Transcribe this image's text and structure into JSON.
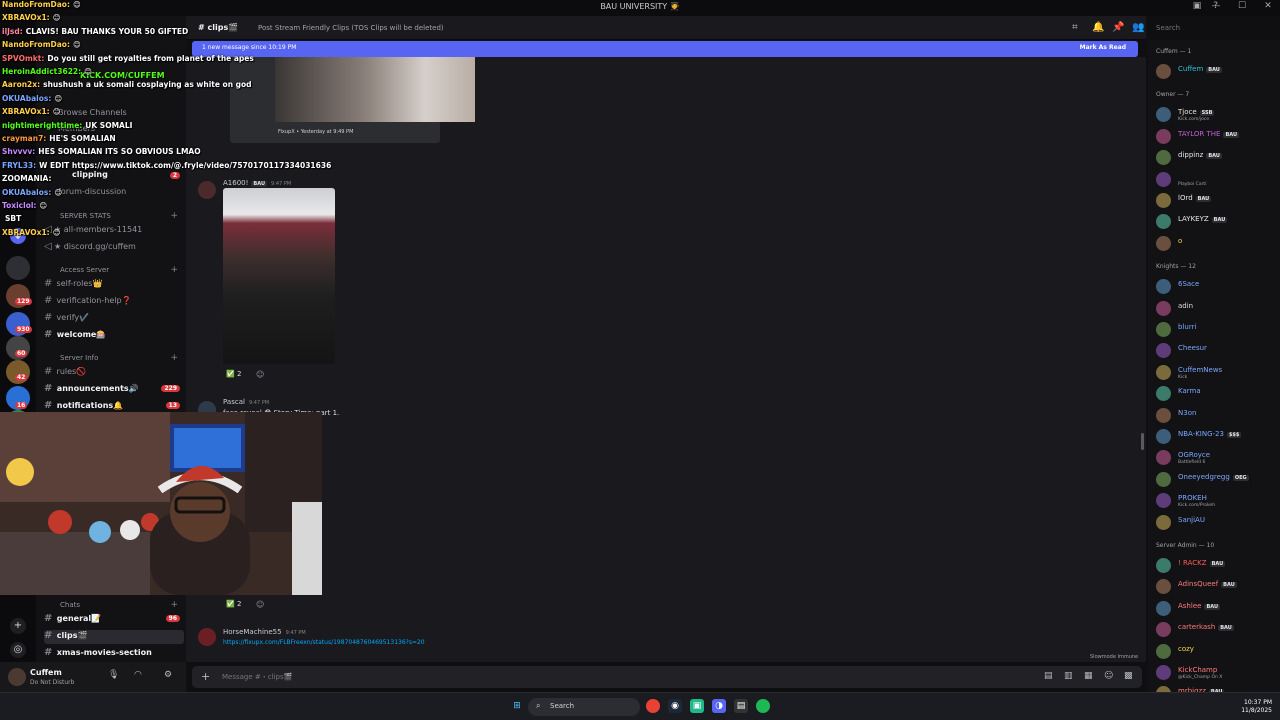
{
  "window": {
    "title": "BAU UNIVERSITY 🧑‍🎓"
  },
  "server_rail": {
    "badges": [
      "129",
      "930",
      "60",
      "42",
      "16"
    ]
  },
  "channels": {
    "top_items": [
      "Browse Channels",
      "Members",
      "clipping",
      "forum-discussion"
    ],
    "top_badge": "2",
    "server_stats_cat": "SERVER STATS",
    "stat_channels": [
      "★ all-members-11541",
      "★ discord.gg/cuffem"
    ],
    "access_cat": "Access Server",
    "access_channels": [
      "self-roles👑",
      "verification-help❓",
      "verify✔️"
    ],
    "welcome": "welcome🎰",
    "info_cat": "Server Info",
    "rules": "rules🚫",
    "announcements": "announcements🔊",
    "announcements_badge": "229",
    "notifications": "notifications🔔",
    "notifications_badge": "13",
    "chats_cat": "Chats",
    "general": "general📝",
    "general_badge": "96",
    "clips": "clips🎬",
    "xmas": "xmas-movies-section"
  },
  "user_panel": {
    "name": "Cuffem",
    "status": "Do Not Disturb"
  },
  "header": {
    "channel": "clips🎬",
    "topic": "Post Stream Friendly Clips (TOS Clips will be deleted)",
    "search_placeholder": "Search"
  },
  "new_messages": {
    "text": "1 new message since 10:19 PM",
    "mark_read": "Mark As Read"
  },
  "messages": [
    {
      "embed_footer": "FixupX • Yesterday at 9:49 PM"
    },
    {
      "author": "A1600!",
      "tag": "BAU",
      "time": "9:47 PM",
      "reaction": "2"
    },
    {
      "author": "Pascal",
      "time": "9:47 PM",
      "text": "face reveal 😳 Story Time: part 1.",
      "reaction": "2"
    },
    {
      "author": "HorseMachine55",
      "time": "9:47 PM",
      "link": "https://fixupx.com/FLBFreexn/status/1987048760469513136?s=20"
    }
  ],
  "slowmode": "Slowmode Immune",
  "input_placeholder": "Message #・clips🎬",
  "members": {
    "groups": [
      {
        "label": "Cuffem — 1",
        "items": [
          {
            "name": "Cuffem",
            "tag": "BAU",
            "color": "#2ec4d6"
          }
        ]
      },
      {
        "label": "Owner — 7",
        "items": [
          {
            "name": "Tjoce",
            "tag": "SSB",
            "sub": "Kick.com/joce",
            "color": "#e6e6e6"
          },
          {
            "name": "TAYLOR THE",
            "tag": "BAU",
            "color": "#c45ed6"
          },
          {
            "name": "dippinz",
            "tag": "BAU",
            "color": "#e6e6e6"
          },
          {
            "name": "",
            "sub": "Playboi Carti",
            "color": "#e6e6e6"
          },
          {
            "name": "lOrd",
            "tag": "BAU",
            "color": "#e6e6e6"
          },
          {
            "name": "LAYKEYZ",
            "tag": "BAU",
            "color": "#e6e6e6"
          },
          {
            "name": "o",
            "color": "#f2d94e"
          }
        ]
      },
      {
        "label": "Knights — 12",
        "items": [
          {
            "name": "6Sace",
            "color": "#7aa7ff"
          },
          {
            "name": "adin",
            "color": "#dbdee1"
          },
          {
            "name": "blurri",
            "color": "#7aa7ff"
          },
          {
            "name": "Cheesur",
            "color": "#7aa7ff"
          },
          {
            "name": "CuffemNews",
            "sub": "Kick",
            "color": "#7aa7ff"
          },
          {
            "name": "Karma",
            "color": "#7aa7ff"
          },
          {
            "name": "N3on",
            "color": "#7aa7ff"
          },
          {
            "name": "NBA-KING-23",
            "tag": "$$$",
            "color": "#7aa7ff"
          },
          {
            "name": "OGRoyce",
            "sub": "Battlefield 6",
            "color": "#7aa7ff"
          },
          {
            "name": "Oneeyedgregg",
            "tag": "OEG",
            "color": "#7aa7ff"
          },
          {
            "name": "PROKEH",
            "sub": "Kick.com/Prokeh",
            "color": "#7aa7ff"
          },
          {
            "name": "SanjiAU",
            "color": "#7aa7ff"
          }
        ]
      },
      {
        "label": "Server Admin — 10",
        "items": [
          {
            "name": "! RACKZ",
            "tag": "BAU",
            "color": "#ff5c5c"
          },
          {
            "name": "AdinsQueef",
            "tag": "BAU",
            "color": "#ff7a7a"
          },
          {
            "name": "Ashlee",
            "tag": "BAU",
            "color": "#ff7a7a"
          },
          {
            "name": "carterkash",
            "tag": "BAU",
            "color": "#ff7a7a"
          },
          {
            "name": "cozy",
            "color": "#f2d94e"
          },
          {
            "name": "KickChamp",
            "sub": "@Kick_Champ On X",
            "color": "#ff7a7a"
          },
          {
            "name": "mrbigzz",
            "tag": "BAU",
            "color": "#ff7a7a"
          }
        ]
      }
    ]
  },
  "stream_overlay": {
    "kick_label": "KICK.COM/CUFFEM",
    "lines": [
      {
        "user": "NandoFromDao:",
        "text": "😊",
        "color": "#ffd04a"
      },
      {
        "user": "XBRAVOx1:",
        "text": "😊",
        "color": "#ffd04a"
      },
      {
        "user": "ilJsd:",
        "text": "CLAVIS! BAU THANKS YOUR 50 GIFTED",
        "color": "#ff8aa0"
      },
      {
        "user": "NandoFromDao:",
        "text": "😊",
        "color": "#ffd04a"
      },
      {
        "user": "SPVOmkt:",
        "text": "Do you still get royalties from planet of the apes",
        "color": "#ff6b6b"
      },
      {
        "user": "HeroinAddict3622:",
        "text": "😊",
        "color": "#53fc18"
      },
      {
        "user": "Aaron2x:",
        "text": "shushush a uk somali cosplaying as white on god",
        "color": "#ffd04a"
      },
      {
        "user": "OKUAbalos:",
        "text": "😊",
        "color": "#7aa7ff"
      },
      {
        "user": "XBRAVOx1:",
        "text": "😊",
        "color": "#ffd04a"
      },
      {
        "user": "nightimerighttime:",
        "text": "UK SOMALI",
        "color": "#53fc18"
      },
      {
        "user": "crayman7:",
        "text": "HE'S SOMALIAN",
        "color": "#ff9a3a"
      },
      {
        "user": "Shvvvv:",
        "text": "HES SOMALIAN ITS SO OBVIOUS LMAO",
        "color": "#c98aff"
      },
      {
        "user": "FRYL33:",
        "text": "W EDIT https://www.tiktok.com/@.fryle/video/7570170117334031636",
        "color": "#7aa7ff"
      },
      {
        "user": "ZOOMANIA:",
        "text": "",
        "color": "#ffffff"
      },
      {
        "user": "OKUAbalos:",
        "text": "😊",
        "color": "#7aa7ff"
      },
      {
        "user": "Toxiclol:",
        "text": "😊",
        "color": "#c98aff"
      },
      {
        "user": "",
        "text": "SBT",
        "color": "#ffffff"
      },
      {
        "user": "XBRAVOx1:",
        "text": "😊",
        "color": "#ffd04a"
      }
    ]
  },
  "taskbar": {
    "search_label": "Search",
    "time": "10:37 PM",
    "date": "11/8/2025"
  }
}
